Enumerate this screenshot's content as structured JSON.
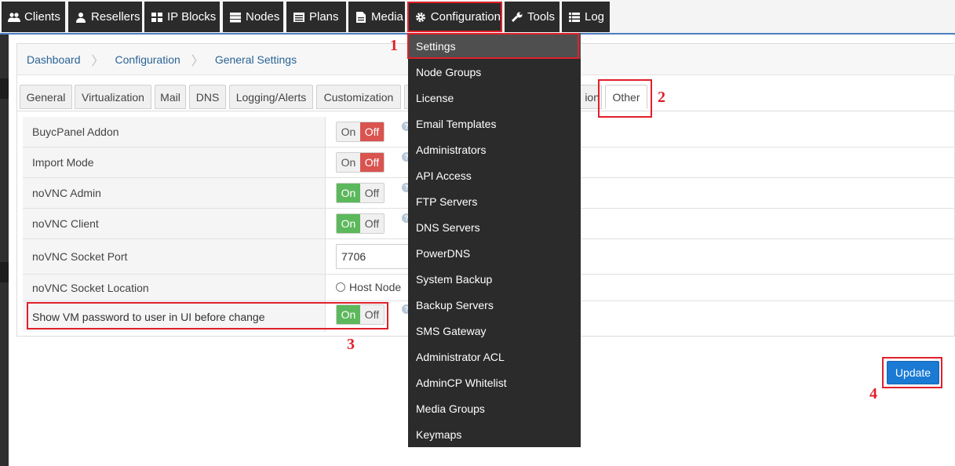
{
  "nav": {
    "items": [
      {
        "label": "Clients",
        "icon": "users-icon"
      },
      {
        "label": "Resellers",
        "icon": "user-icon"
      },
      {
        "label": "IP Blocks",
        "icon": "grid-icon"
      },
      {
        "label": "Nodes",
        "icon": "server-icon"
      },
      {
        "label": "Plans",
        "icon": "list-icon"
      },
      {
        "label": "Media",
        "icon": "file-icon"
      },
      {
        "label": "Configuration",
        "icon": "gear-icon"
      },
      {
        "label": "Tools",
        "icon": "wrench-icon"
      },
      {
        "label": "Log",
        "icon": "list-icon"
      }
    ]
  },
  "breadcrumb": [
    "Dashboard",
    "Configuration",
    "General Settings"
  ],
  "tabs": [
    "General",
    "Virtualization",
    "Mail",
    "DNS",
    "Logging/Alerts",
    "Customization",
    "ion",
    "Other"
  ],
  "settings": [
    {
      "label": "BuycPanel Addon",
      "type": "toggle",
      "on_label": "On",
      "off_label": "Off",
      "state": "off"
    },
    {
      "label": "Import Mode",
      "type": "toggle",
      "on_label": "On",
      "off_label": "Off",
      "state": "off"
    },
    {
      "label": "noVNC Admin",
      "type": "toggle",
      "on_label": "On",
      "off_label": "Off",
      "state": "on"
    },
    {
      "label": "noVNC Client",
      "type": "toggle",
      "on_label": "On",
      "off_label": "Off",
      "state": "on"
    },
    {
      "label": "noVNC Socket Port",
      "type": "text",
      "value": "7706"
    },
    {
      "label": "noVNC Socket Location",
      "type": "radio",
      "option": "Host Node"
    },
    {
      "label": "Show VM password to user in UI before change",
      "type": "toggle",
      "on_label": "On",
      "off_label": "Off",
      "state": "on"
    }
  ],
  "dropdown": {
    "items": [
      "Settings",
      "Node Groups",
      "License",
      "Email Templates",
      "Administrators",
      "API Access",
      "FTP Servers",
      "DNS Servers",
      "PowerDNS",
      "System Backup",
      "Backup Servers",
      "SMS Gateway",
      "Administrator ACL",
      "AdminCP Whitelist",
      "Media Groups",
      "Keymaps"
    ]
  },
  "update_label": "Update",
  "annotations": {
    "m1": "1",
    "m2": "2",
    "m3": "3",
    "m4": "4"
  },
  "colors": {
    "nav_bg": "#2b2b2b",
    "on_green": "#5cb85c",
    "off_red": "#d9534f",
    "accent_blue": "#1a7ad4",
    "annotation_red": "#e0202a"
  }
}
